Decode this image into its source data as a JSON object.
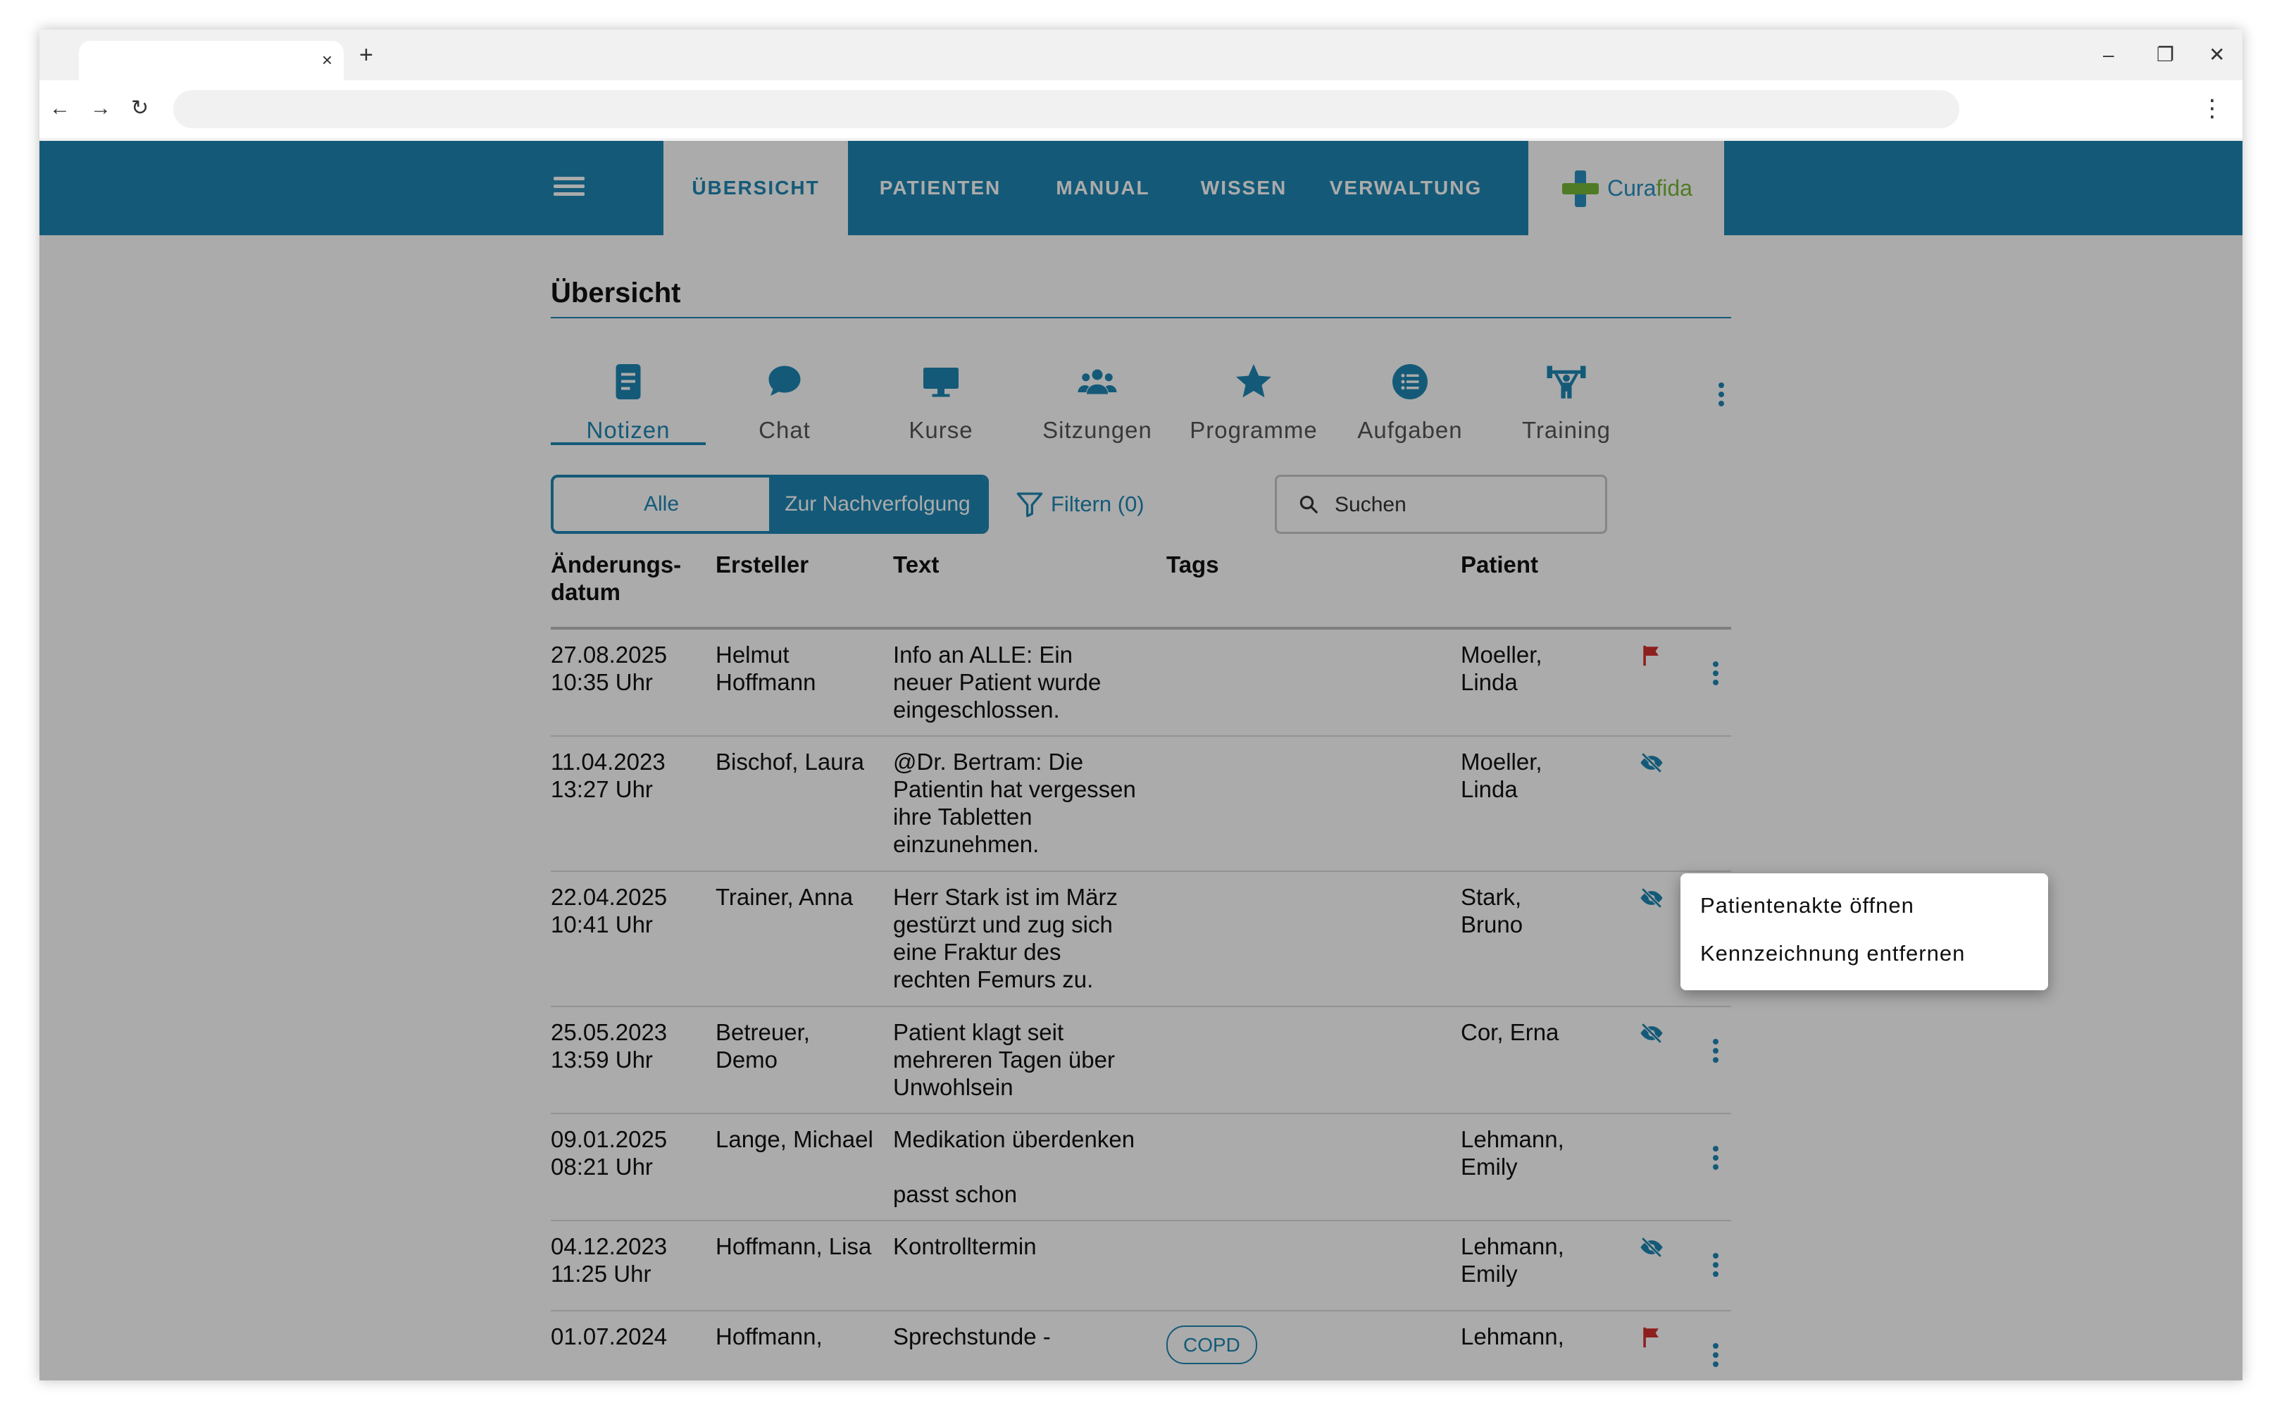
{
  "browser": {
    "tab_close": "×",
    "new_tab": "+",
    "back": "←",
    "forward": "→",
    "reload": "↻",
    "minimize": "–",
    "restore": "❐",
    "close": "✕",
    "menu": "⋮"
  },
  "topnav": {
    "items": [
      {
        "label": "ÜBERSICHT",
        "active": true
      },
      {
        "label": "PATIENTEN",
        "active": false
      },
      {
        "label": "MANUAL",
        "active": false
      },
      {
        "label": "WISSEN",
        "active": false
      },
      {
        "label": "VERWALTUNG",
        "active": false
      }
    ],
    "logo": {
      "part1": "Cura",
      "part2": "fida"
    }
  },
  "page": {
    "title": "Übersicht"
  },
  "icon_tabs": [
    {
      "label": "Notizen",
      "icon": "note-icon",
      "active": true
    },
    {
      "label": "Chat",
      "icon": "chat-icon",
      "active": false
    },
    {
      "label": "Kurse",
      "icon": "monitor-icon",
      "active": false
    },
    {
      "label": "Sitzungen",
      "icon": "group-icon",
      "active": false
    },
    {
      "label": "Programme",
      "icon": "star-icon",
      "active": false
    },
    {
      "label": "Aufgaben",
      "icon": "list-icon",
      "active": false
    },
    {
      "label": "Training",
      "icon": "weightlifting-icon",
      "active": false
    }
  ],
  "filters": {
    "toggle_all": "Alle",
    "toggle_follow": "Zur Nachverfolgung",
    "filter_label": "Filtern (0)",
    "search_placeholder": "Suchen"
  },
  "table": {
    "headers": {
      "date": "Änderungs-\ndatum",
      "author": "Ersteller",
      "text": "Text",
      "tags": "Tags",
      "patient": "Patient"
    },
    "rows": [
      {
        "date": "27.08.2025\n10:35 Uhr",
        "author": "Helmut\nHoffmann",
        "text": "Info an ALLE: Ein\nneuer Patient wurde\neingeschlossen.",
        "tags": "",
        "patient": "Moeller,\nLinda",
        "status": "flag"
      },
      {
        "date": "11.04.2023\n13:27 Uhr",
        "author": "Bischof, Laura",
        "text": "@Dr. Bertram: Die\nPatientin hat vergessen\nihre Tabletten\neinzunehmen.",
        "tags": "",
        "patient": "Moeller,\nLinda",
        "status": "hidden"
      },
      {
        "date": "22.04.2025\n10:41 Uhr",
        "author": "Trainer, Anna",
        "text": "Herr Stark ist im März\ngestürzt und zug sich\neine Fraktur des\nrechten Femurs zu.",
        "tags": "",
        "patient": "Stark,\nBruno",
        "status": "hidden"
      },
      {
        "date": "25.05.2023\n13:59 Uhr",
        "author": "Betreuer,\nDemo",
        "text": "Patient klagt seit\nmehreren Tagen über\nUnwohlsein",
        "tags": "",
        "patient": "Cor, Erna",
        "status": "hidden"
      },
      {
        "date": "09.01.2025\n08:21 Uhr",
        "author": "Lange, Michael",
        "text": "Medikation überdenken\n\npasst schon",
        "tags": "",
        "patient": "Lehmann,\nEmily",
        "status": ""
      },
      {
        "date": "04.12.2023\n11:25 Uhr",
        "author": "Hoffmann, Lisa",
        "text": "Kontrolltermin",
        "tags": "",
        "patient": "Lehmann,\nEmily",
        "status": "hidden"
      },
      {
        "date": "01.07.2024",
        "author": "Hoffmann,",
        "text": "Sprechstunde -",
        "tags": "COPD",
        "patient": "Lehmann,",
        "status": "flag"
      }
    ]
  },
  "context_menu": {
    "items": [
      "Patientenakte öffnen",
      "Kennzeichnung entfernen"
    ]
  },
  "colors": {
    "primary": "#1f86b4",
    "flag": "#d32f2f",
    "logo_green": "#78b83a"
  }
}
